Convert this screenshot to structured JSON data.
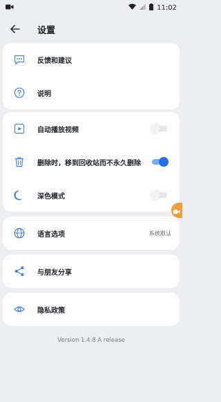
{
  "status_bar": {
    "time": "11:02",
    "left_icon": "video-record-icon",
    "right_icons": [
      "wifi-icon",
      "signal-icon",
      "battery-icon"
    ]
  },
  "header": {
    "back_icon": "arrow-left-icon",
    "title": "设置"
  },
  "items": {
    "feedback": {
      "icon": "chat-icon",
      "label": "反馈和建议"
    },
    "help": {
      "icon": "help-circle-icon",
      "label": "说明"
    },
    "autoplay": {
      "icon": "play-square-icon",
      "label": "自动播放视频",
      "enabled": false
    },
    "delete_permanent": {
      "icon": "trash-icon",
      "label": "删除时，移到回收站而不永久删除",
      "enabled": true
    },
    "dark_mode": {
      "icon": "moon-icon",
      "label": "深色模式",
      "enabled": false
    },
    "language": {
      "icon": "globe-icon",
      "label": "语言选项",
      "value": "系统默认"
    },
    "share": {
      "icon": "share-icon",
      "label": "与朋友分享"
    },
    "privacy": {
      "icon": "eye-icon",
      "label": "隐私政策"
    }
  },
  "version": "Version 1.4.8 A release",
  "colors": {
    "accent": "#1e6ff2",
    "icon": "#4a7fd4",
    "background": "#eceef2",
    "floating": "#f59f3a"
  }
}
